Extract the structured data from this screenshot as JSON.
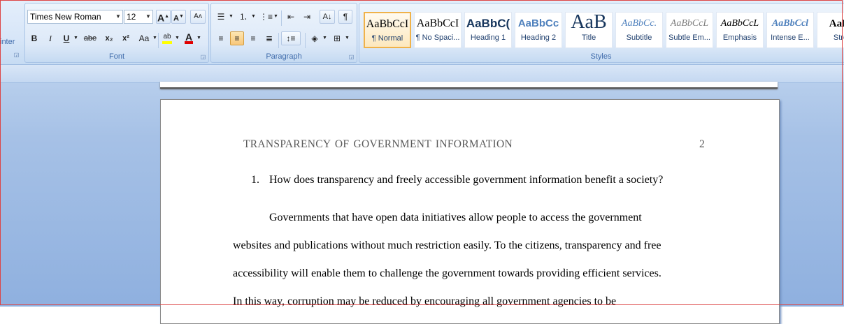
{
  "clipboard": {
    "partial_label": "inter"
  },
  "font": {
    "group_label": "Font",
    "family": "Times New Roman",
    "size": "12",
    "grow_label": "A",
    "shrink_label": "A",
    "bold_label": "B",
    "italic_label": "I",
    "underline_label": "U",
    "strike_label": "abe",
    "subscript_label": "x₂",
    "superscript_label": "x²",
    "changecase_label": "Aa",
    "highlight_label": "ab",
    "fontcolor_label": "A"
  },
  "paragraph": {
    "group_label": "Paragraph"
  },
  "styles": {
    "group_label": "Styles",
    "items": [
      {
        "sample": "AaBbCcI",
        "name": "¶ Normal"
      },
      {
        "sample": "AaBbCcI",
        "name": "¶ No Spaci..."
      },
      {
        "sample": "AaBbC(",
        "name": "Heading 1"
      },
      {
        "sample": "AaBbCc",
        "name": "Heading 2"
      },
      {
        "sample": "AaB",
        "name": "Title"
      },
      {
        "sample": "AaBbCc.",
        "name": "Subtitle"
      },
      {
        "sample": "AaBbCcL",
        "name": "Subtle Em..."
      },
      {
        "sample": "AaBbCcL",
        "name": "Emphasis"
      },
      {
        "sample": "AaBbCcl",
        "name": "Intense E..."
      },
      {
        "sample": "AaBl",
        "name": "Stro"
      }
    ]
  },
  "document": {
    "header_title": "TRANSPARENCY OF GOVERNMENT INFORMATION",
    "page_number": "2",
    "question_number": "1.",
    "question": "How does transparency and freely accessible government information benefit a society?",
    "lines": [
      "Governments that have open data initiatives allow people to access the government",
      "websites and publications without much restriction easily. To the citizens, transparency and free",
      "accessibility will enable them to challenge the government towards providing efficient services.",
      "In this way, corruption may be reduced by encouraging all government agencies to be"
    ]
  },
  "colors": {
    "highlight": "#ffff00",
    "font_color": "#e00000",
    "selected_style": "#f0b24a"
  }
}
